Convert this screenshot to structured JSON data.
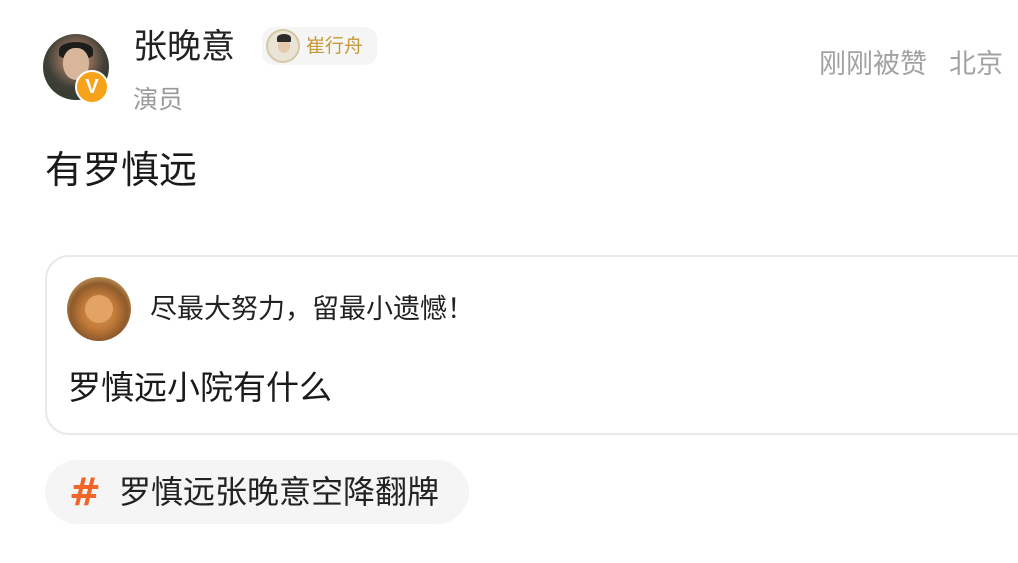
{
  "header": {
    "username": "张晚意",
    "verified_badge": "V",
    "role_tag": "崔行舟",
    "description": "演员",
    "status": "刚刚被赞",
    "location": "北京"
  },
  "post": {
    "text": "有罗慎远"
  },
  "quote": {
    "username": "尽最大努力，留最小遗憾！",
    "text": "罗慎远小院有什么"
  },
  "topic": {
    "hash_symbol": "#",
    "label": "罗慎远张晚意空降翻牌"
  },
  "colors": {
    "verified_badge": "#f7a21b",
    "role_tag_text": "#c69a3a",
    "topic_hash": "#f2652a",
    "meta_text": "#a2a2a2"
  },
  "icons": {
    "verified": "verified-v-icon",
    "topic": "hashtag-icon"
  }
}
